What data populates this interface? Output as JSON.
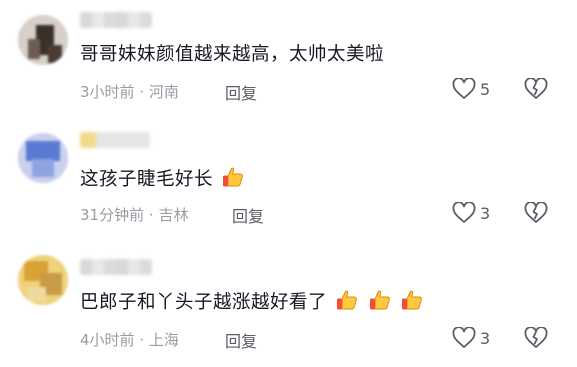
{
  "comments": [
    {
      "text": "哥哥妹妹颜值越来越高，太帅太美啦",
      "thumbs": 0,
      "time": "3小时前",
      "location": "河南",
      "reply_label": "回复",
      "likes": "5"
    },
    {
      "text": "这孩子睫毛好长",
      "thumbs": 1,
      "time": "31分钟前",
      "location": "吉林",
      "reply_label": "回复",
      "likes": "3"
    },
    {
      "text": "巴郎子和丫头子越涨越好看了",
      "thumbs": 3,
      "time": "4小时前",
      "location": "上海",
      "reply_label": "回复",
      "likes": "3"
    }
  ],
  "meta_separator": "·",
  "icons": {
    "like": "heart-outline-icon",
    "dislike": "broken-heart-outline-icon",
    "emoji": "thumbs-up-emoji-icon"
  }
}
